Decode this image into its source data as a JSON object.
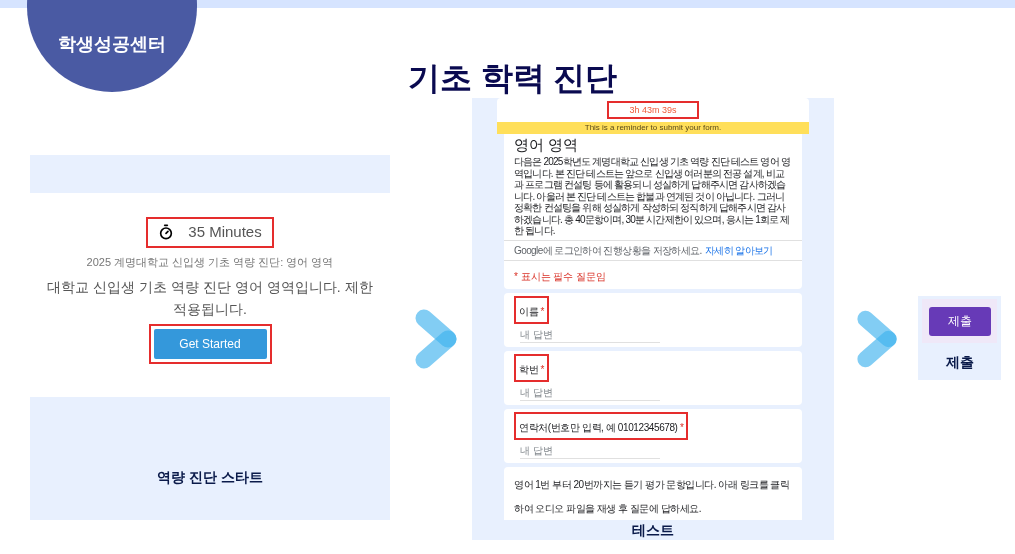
{
  "badge": "학생성공센터",
  "title": "기초 학력 진단",
  "start": {
    "duration": {
      "text": "35 Minutes",
      "highlighted": true
    },
    "subtitle": "2025 계명대학교 신입생 기초 역량 진단: 영어 영역",
    "intro_lines": [
      "대학교 신입생 기초 역량 진단 영어 영역입니다. 제한",
      "적용됩니다."
    ],
    "button": {
      "label": "Get Started",
      "highlighted": true
    },
    "caption": "역량 진단 스타트"
  },
  "test": {
    "timer": {
      "text": "3h 43m 39s",
      "highlighted": true
    },
    "banner": "This is a reminder to submit your form.",
    "heading": "영어 영역",
    "description": "다음은 2025학년도 계명대학교 신입생 기초 역량 진단 테스트 영어 영역입니다. 본 진단 테스트는 앞으로 신입생 여러분의 전공 설계, 비교과 프로그램 컨설팅 등에 활용되니 성실하게 답해주시면 감사하겠습니다. 아울러 본 진단 테스트는 합불과 연계된 것이 아닙니다. 그러니 정확한 컨설팅을 위해 성실하게 작성하되 정직하게 답해주시면 감사하겠습니다. 총 40문항이며, 30분 시간제한이 있으며, 응시는 1회로 제한 됩니다.",
    "sign_in_note": "Google에 로그인하여 진행상황을 저장하세요.",
    "learn_more_link": "자세히 알아보기",
    "required_note": "* 표시는 필수 질문임",
    "questions": [
      {
        "label": "이름",
        "required_mark": "*",
        "placeholder": "내 답변",
        "highlighted": true
      },
      {
        "label": "학번",
        "required_mark": "*",
        "placeholder": "내 답변",
        "highlighted": true
      },
      {
        "label": "연락처(번호만 입력, 예 01012345678)",
        "required_mark": "*",
        "placeholder": "내 답변",
        "highlighted": true
      }
    ],
    "notice": "영어 1번 부터 20번까지는 듣기 평가 문항입니다. 아래 링크를 클릭하여 오디오 파일을 재생 후 질문에 답하세요.",
    "caption": "테스트"
  },
  "submit": {
    "button": "제출",
    "caption": "제출"
  }
}
